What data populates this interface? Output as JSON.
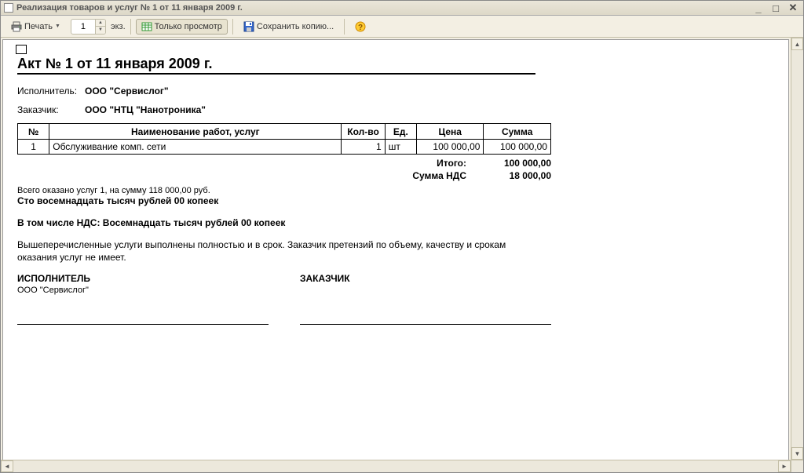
{
  "window": {
    "title": "Реализация товаров и услуг № 1 от 11 января 2009 г."
  },
  "toolbar": {
    "print_label": "Печать",
    "copies_value": "1",
    "copies_suffix": "экз.",
    "preview_label": "Только просмотр",
    "save_copy_label": "Сохранить копию..."
  },
  "document": {
    "title": "Акт № 1 от 11 января 2009 г.",
    "executor_label": "Исполнитель:",
    "executor_value": "ООО \"Сервислог\"",
    "customer_label": "Заказчик:",
    "customer_value": "ООО \"НТЦ \"Нанотроника\"",
    "table": {
      "headers": {
        "num": "№",
        "name": "Наименование работ, услуг",
        "qty": "Кол-во",
        "unit": "Ед.",
        "price": "Цена",
        "sum": "Сумма"
      },
      "rows": [
        {
          "num": "1",
          "name": "Обслуживание комп. сети",
          "qty": "1",
          "unit": "шт",
          "price": "100 000,00",
          "sum": "100 000,00"
        }
      ]
    },
    "totals": {
      "total_label": "Итого:",
      "total_value": "100 000,00",
      "vat_label": "Сумма НДС",
      "vat_value": "18 000,00"
    },
    "summary_line": "Всего оказано услуг 1, на сумму 118 000,00 руб.",
    "amount_words": "Сто восемнадцать тысяч рублей 00 копеек",
    "vat_words": "В том числе НДС: Восемнадцать тысяч рублей 00 копеек",
    "disclaimer": "Вышеперечисленные услуги выполнены полностью и в срок. Заказчик претензий по объему, качеству и срокам оказания услуг не имеет.",
    "signatures": {
      "executor_title": "ИСПОЛНИТЕЛЬ",
      "executor_company": "ООО \"Сервислог\"",
      "customer_title": "ЗАКАЗЧИК"
    }
  }
}
